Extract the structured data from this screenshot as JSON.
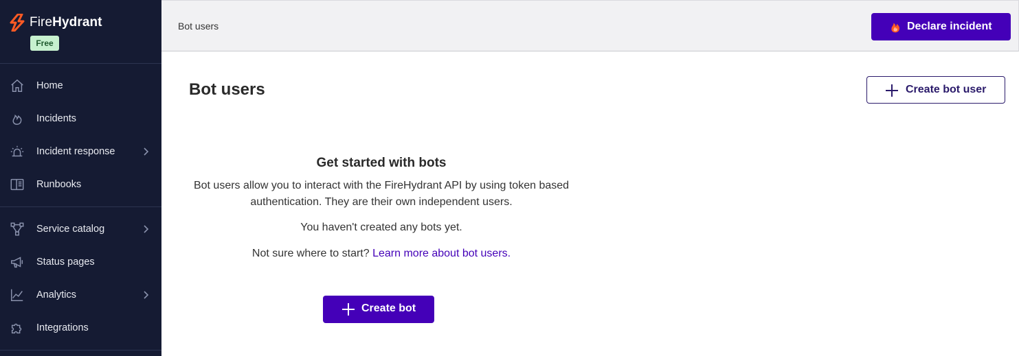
{
  "app": {
    "brand_part1": "Fire",
    "brand_part2": "Hydrant",
    "plan_badge": "Free"
  },
  "sidebar": {
    "items": [
      {
        "label": "Home",
        "icon": "home-icon",
        "has_submenu": false
      },
      {
        "label": "Incidents",
        "icon": "flame-icon",
        "has_submenu": false
      },
      {
        "label": "Incident response",
        "icon": "siren-icon",
        "has_submenu": true
      },
      {
        "label": "Runbooks",
        "icon": "book-icon",
        "has_submenu": false
      },
      {
        "label": "Service catalog",
        "icon": "graph-icon",
        "has_submenu": true
      },
      {
        "label": "Status pages",
        "icon": "megaphone-icon",
        "has_submenu": false
      },
      {
        "label": "Analytics",
        "icon": "chart-icon",
        "has_submenu": true
      },
      {
        "label": "Integrations",
        "icon": "puzzle-icon",
        "has_submenu": false
      }
    ]
  },
  "header": {
    "breadcrumb": "Bot users",
    "declare_label": "Declare incident"
  },
  "main": {
    "title": "Bot users",
    "create_user_label": "Create bot user",
    "empty": {
      "title": "Get started with bots",
      "description": "Bot users allow you to interact with the FireHydrant API by using token based authentication. They are their own independent users.",
      "none_text": "You haven't created any bots yet.",
      "help_prefix": "Not sure where to start?",
      "help_link": "Learn more about bot users.",
      "create_label": "Create bot"
    }
  },
  "colors": {
    "sidebar_bg": "#151b33",
    "accent": "#4400b8",
    "logo": "#ff5a24",
    "badge_bg": "#c7f1cf"
  }
}
